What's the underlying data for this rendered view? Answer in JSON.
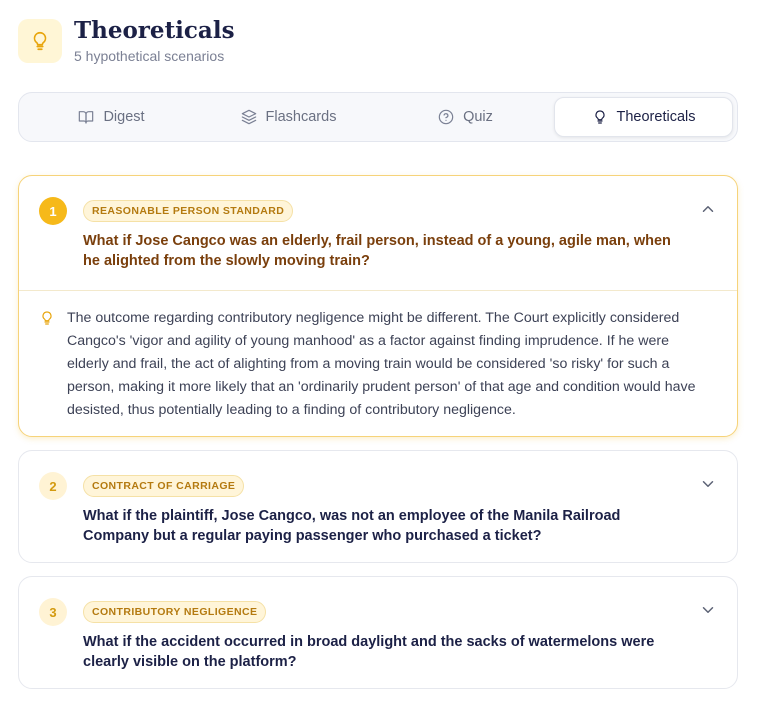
{
  "header": {
    "icon": "lightbulb-icon",
    "title": "Theoreticals",
    "subtitle": "5 hypothetical scenarios"
  },
  "tabs": [
    {
      "label": "Digest",
      "icon": "book-open-icon",
      "active": false
    },
    {
      "label": "Flashcards",
      "icon": "layers-icon",
      "active": false
    },
    {
      "label": "Quiz",
      "icon": "help-circle-icon",
      "active": false
    },
    {
      "label": "Theoreticals",
      "icon": "lightbulb-icon",
      "active": true
    }
  ],
  "colors": {
    "accent": "#f6b91a",
    "badge_text": "#b47a10",
    "expanded_border": "#f6d37a",
    "question_expanded": "#7a3f0c"
  },
  "scenarios": [
    {
      "number": "1",
      "tag": "REASONABLE PERSON STANDARD",
      "question": "What if Jose Cangco was an elderly, frail person, instead of a young, agile man, when he alighted from the slowly moving train?",
      "expanded": true,
      "answer": "The outcome regarding contributory negligence might be different. The Court explicitly considered Cangco's 'vigor and agility of young manhood' as a factor against finding imprudence. If he were elderly and frail, the act of alighting from a moving train would be considered 'so risky' for such a person, making it more likely that an 'ordinarily prudent person' of that age and condition would have desisted, thus potentially leading to a finding of contributory negligence."
    },
    {
      "number": "2",
      "tag": "CONTRACT OF CARRIAGE",
      "question": "What if the plaintiff, Jose Cangco, was not an employee of the Manila Railroad Company but a regular paying passenger who purchased a ticket?",
      "expanded": false
    },
    {
      "number": "3",
      "tag": "CONTRIBUTORY NEGLIGENCE",
      "question": "What if the accident occurred in broad daylight and the sacks of watermelons were clearly visible on the platform?",
      "expanded": false
    }
  ]
}
